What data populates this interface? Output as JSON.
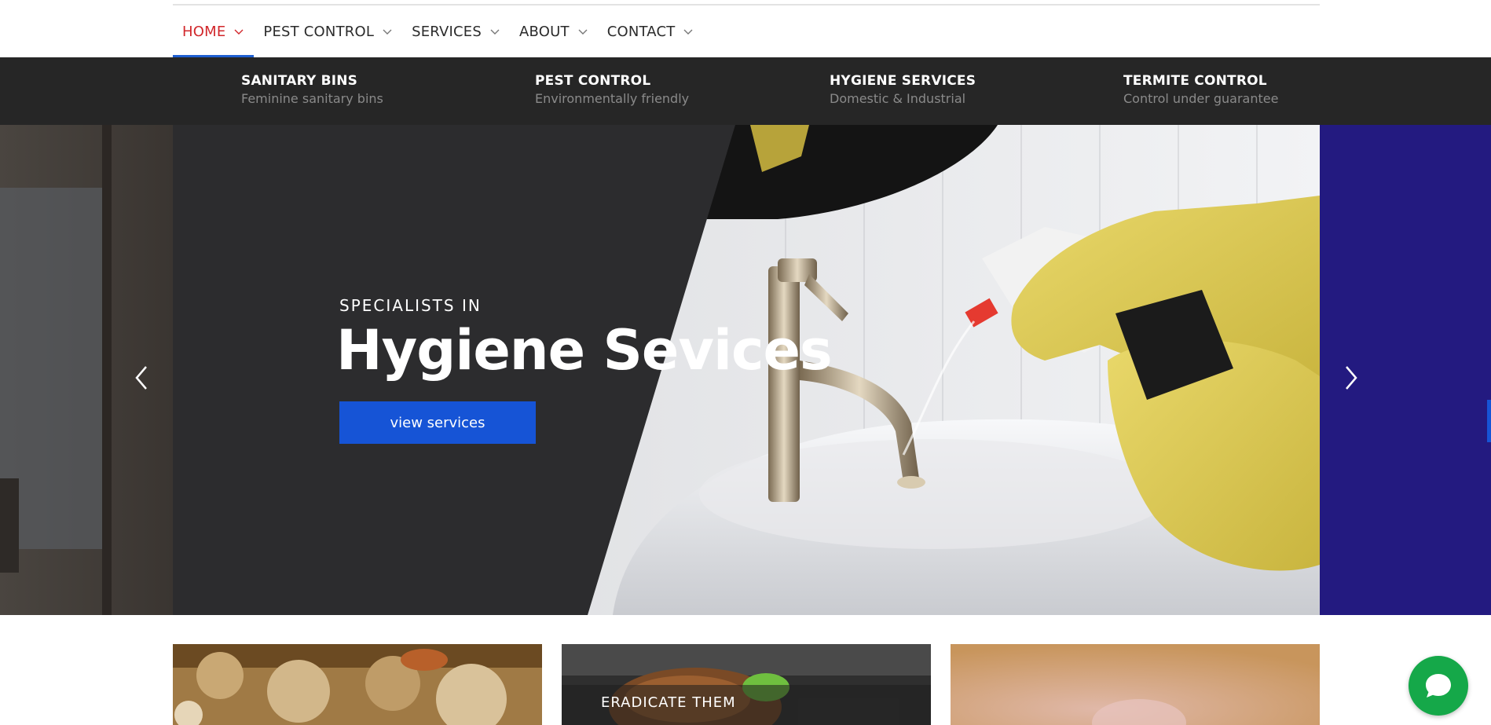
{
  "nav": {
    "items": [
      {
        "label": "HOME",
        "active": true
      },
      {
        "label": "PEST CONTROL",
        "active": false
      },
      {
        "label": "SERVICES",
        "active": false
      },
      {
        "label": "ABOUT",
        "active": false
      },
      {
        "label": "CONTACT",
        "active": false
      }
    ],
    "active_color": "#d1272b",
    "active_underline_color": "#1f5fd1"
  },
  "features": [
    {
      "title": "SANITARY BINS",
      "subtitle": "Feminine sanitary bins"
    },
    {
      "title": "PEST CONTROL",
      "subtitle": "Environmentally friendly"
    },
    {
      "title": "HYGIENE SERVICES",
      "subtitle": "Domestic & Industrial"
    },
    {
      "title": "TERMITE CONTROL",
      "subtitle": "Control under guarantee"
    }
  ],
  "hero": {
    "eyebrow": "SPECIALISTS IN",
    "title": "Hygiene Sevices",
    "button_label": "view services",
    "button_color": "#1654d6",
    "prev_icon": "chevron-left-icon",
    "next_icon": "chevron-right-icon"
  },
  "cards": [
    {
      "label": ""
    },
    {
      "label": "ERADICATE THEM"
    },
    {
      "label": ""
    }
  ],
  "chat": {
    "icon": "chat-bubble-icon",
    "color": "#15a849"
  }
}
